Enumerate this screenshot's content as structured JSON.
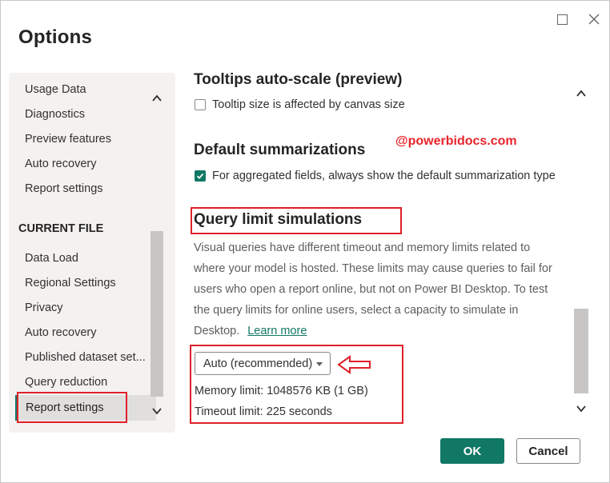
{
  "dialog": {
    "title": "Options",
    "maximize_icon": "maximize-icon",
    "close_icon": "close-icon"
  },
  "sidebar": {
    "items_top": [
      {
        "label": "Usage Data"
      },
      {
        "label": "Diagnostics"
      },
      {
        "label": "Preview features"
      },
      {
        "label": "Auto recovery"
      },
      {
        "label": "Report settings"
      }
    ],
    "section_title": "CURRENT FILE",
    "items_file": [
      {
        "label": "Data Load"
      },
      {
        "label": "Regional Settings"
      },
      {
        "label": "Privacy"
      },
      {
        "label": "Auto recovery"
      },
      {
        "label": "Published dataset set..."
      },
      {
        "label": "Query reduction"
      }
    ],
    "selected_label": "Report settings"
  },
  "main": {
    "tooltips": {
      "heading": "Tooltips auto-scale (preview)",
      "checkbox_label": "Tooltip size is affected by canvas size",
      "checked": false
    },
    "watermark": "@powerbidocs.com",
    "summarizations": {
      "heading": "Default summarizations",
      "checkbox_label": "For aggregated fields, always show the default summarization type",
      "checked": true
    },
    "query_limit": {
      "heading": "Query limit simulations",
      "description": "Visual queries have different timeout and memory limits related to where your model is hosted. These limits may cause queries to fail for users who open a report online, but not on Power BI Desktop. To test the query limits for online users, select a capacity to simulate in Desktop.",
      "learn_more": "Learn more",
      "dropdown_value": "Auto (recommended)",
      "memory_limit": "Memory limit: 1048576 KB (1 GB)",
      "timeout_limit": "Timeout limit: 225 seconds"
    }
  },
  "footer": {
    "ok_label": "OK",
    "cancel_label": "Cancel"
  },
  "colors": {
    "accent": "#117865",
    "annotation": "#e0202a"
  }
}
